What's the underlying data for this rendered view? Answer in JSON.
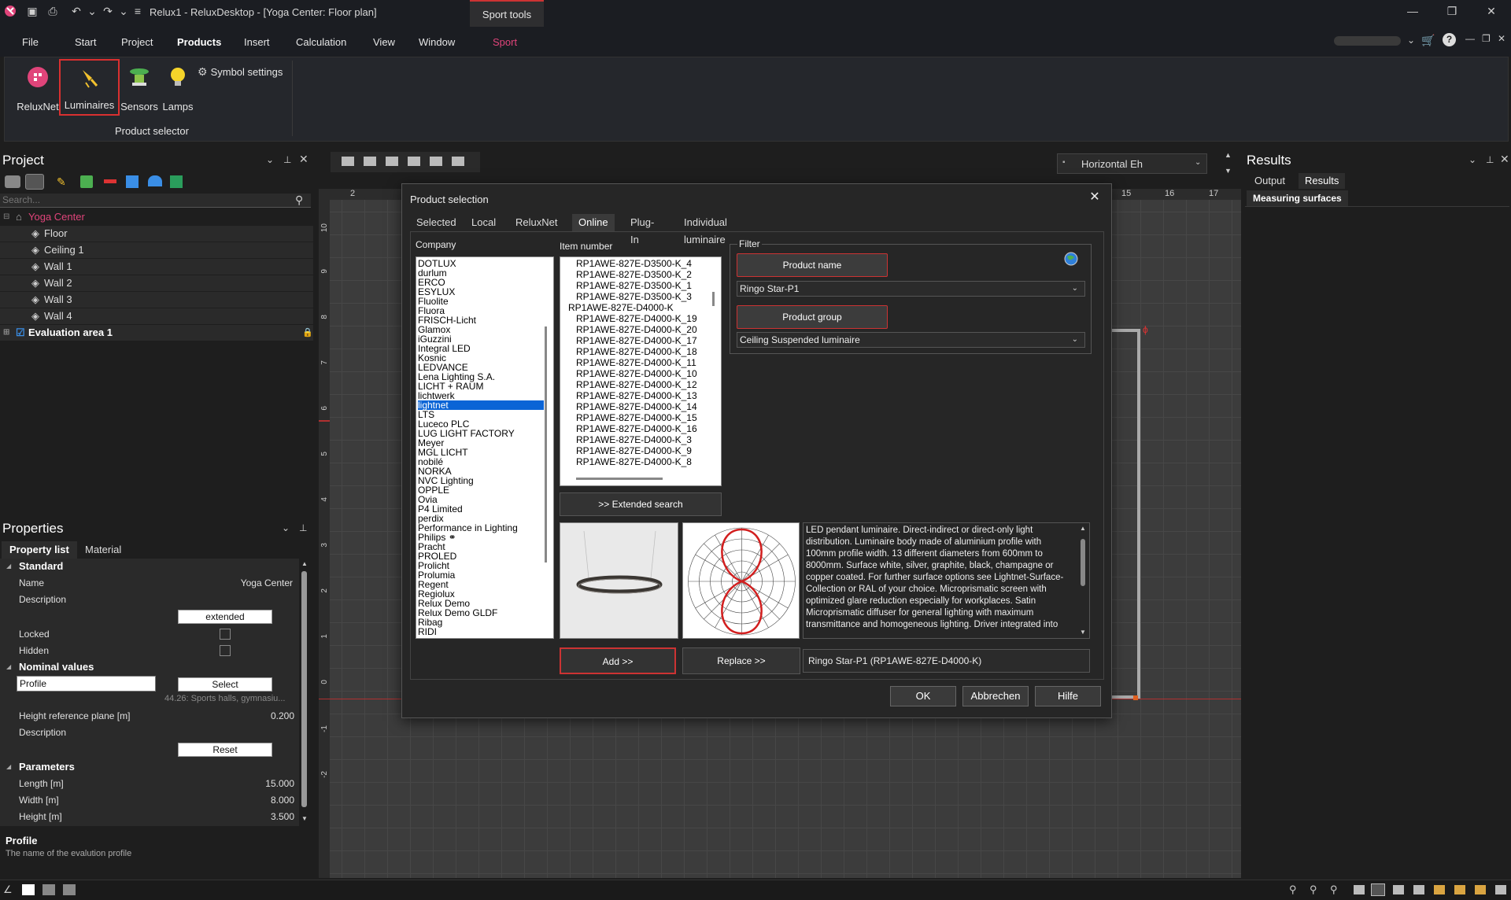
{
  "app": {
    "title": "Relux1 - ReluxDesktop - [Yoga Center: Floor plan]",
    "context_tab": "Sport tools"
  },
  "menu": [
    "File",
    "Start",
    "Project",
    "Products",
    "Insert",
    "Calculation",
    "View",
    "Window",
    "Sport"
  ],
  "ribbon": {
    "relux_net": "ReluxNet",
    "luminaires": "Luminaires",
    "sensors": "Sensors",
    "lamps": "Lamps",
    "symbol_settings": "Symbol settings",
    "group_label": "Product selector"
  },
  "project": {
    "title": "Project",
    "search_placeholder": "Search...",
    "tree": [
      "Yoga Center",
      "Floor",
      "Ceiling 1",
      "Wall 1",
      "Wall 2",
      "Wall 3",
      "Wall 4",
      "Evaluation area 1"
    ]
  },
  "properties": {
    "title": "Properties",
    "tabs": [
      "Property list",
      "Material"
    ],
    "standard": "Standard",
    "name_key": "Name",
    "name_val": "Yoga Center",
    "description": "Description",
    "extended": "extended",
    "locked": "Locked",
    "hidden": "Hidden",
    "nominal": "Nominal values",
    "profile": "Profile",
    "select": "Select",
    "profile_hint": "44.26: Sports halls, gymnasiu...",
    "height_ref": "Height reference plane [m]",
    "height_ref_val": "0.200",
    "description2": "Description",
    "reset": "Reset",
    "parameters": "Parameters",
    "length": "Length [m]",
    "length_val": "15.000",
    "width": "Width [m]",
    "width_val": "8.000",
    "height": "Height [m]",
    "height_val": "3.500",
    "footer_title": "Profile",
    "footer_desc": "The name of the evalution profile"
  },
  "view": {
    "select": "Horizontal Eh",
    "ruler_top": [
      "2",
      "15",
      "16",
      "17"
    ],
    "ruler_left": [
      "10",
      "9",
      "8",
      "7",
      "6",
      "5",
      "4",
      "3",
      "2",
      "1",
      "0",
      "-1",
      "-2"
    ]
  },
  "results": {
    "title": "Results",
    "tabs": [
      "Output",
      "Results"
    ],
    "measuring": "Measuring surfaces"
  },
  "dialog": {
    "title": "Product selection",
    "tabs": [
      "Selected",
      "Local",
      "ReluxNet",
      "Online",
      "Plug-In",
      "Individual luminaire"
    ],
    "company_label": "Company",
    "item_label": "Item number",
    "filter_label": "Filter",
    "companies": [
      "DOTLUX",
      "durlum",
      "ERCO",
      "ESYLUX",
      "Fluolite",
      "Fluora",
      "FRISCH-Licht",
      "Glamox",
      "iGuzzini",
      "Integral LED",
      "Kosnic",
      "LEDVANCE",
      "Lena Lighting S.A.",
      "LICHT + RAUM",
      "lichtwerk",
      "lightnet",
      "LTS",
      "Luceco PLC",
      "LUG LIGHT FACTORY",
      "Meyer",
      "MGL LICHT",
      "nobilé",
      "NORKA",
      "NVC Lighting",
      "OPPLE",
      "Ovia",
      "P4 Limited",
      "perdix",
      "Performance in Lighting",
      "Philips ⚭",
      "Pracht",
      "PROLED",
      "Prolicht",
      "Prolumia",
      "Regent",
      "Regiolux",
      "Relux Demo",
      "Relux Demo GLDF",
      "Ribag",
      "RIDI"
    ],
    "selected_company": "lightnet",
    "items": [
      "RP1AWE-827E-D3500-K_4",
      "RP1AWE-827E-D3500-K_2",
      "RP1AWE-827E-D3500-K_1",
      "RP1AWE-827E-D3500-K_3",
      "RP1AWE-827E-D4000-K",
      "RP1AWE-827E-D4000-K_19",
      "RP1AWE-827E-D4000-K_20",
      "RP1AWE-827E-D4000-K_17",
      "RP1AWE-827E-D4000-K_18",
      "RP1AWE-827E-D4000-K_11",
      "RP1AWE-827E-D4000-K_10",
      "RP1AWE-827E-D4000-K_12",
      "RP1AWE-827E-D4000-K_13",
      "RP1AWE-827E-D4000-K_14",
      "RP1AWE-827E-D4000-K_15",
      "RP1AWE-827E-D4000-K_16",
      "RP1AWE-827E-D4000-K_3",
      "RP1AWE-827E-D4000-K_9",
      "RP1AWE-827E-D4000-K_8"
    ],
    "extended_search": ">> Extended search",
    "product_name_btn": "Product name",
    "product_name_val": "Ringo Star-P1",
    "product_group_btn": "Product group",
    "product_group_val": "Ceiling Suspended luminaire",
    "description": "LED pendant luminaire. Direct-indirect or direct-only light distribution. Luminaire body made of aluminium profile with 100mm profile width. 13 different diameters from 600mm to 8000mm. Surface white, silver, graphite, black, champagne or copper coated. For further surface options see Lightnet-Surface-Collection or RAL of your choice. Microprismatic screen with optimized glare reduction especially for workplaces. Satin Microprismatic diffuser for general lighting with maximum transmittance and homogeneous lighting. Driver integrated into",
    "add": "Add >>",
    "replace": "Replace >>",
    "selected_product": "Ringo Star-P1 (RP1AWE-827E-D4000-K)",
    "ok": "OK",
    "cancel": "Abbrechen",
    "help": "Hilfe"
  },
  "colors": {
    "accent": "#e0447a",
    "highlight": "#d93030",
    "selection": "#0a64d6"
  }
}
